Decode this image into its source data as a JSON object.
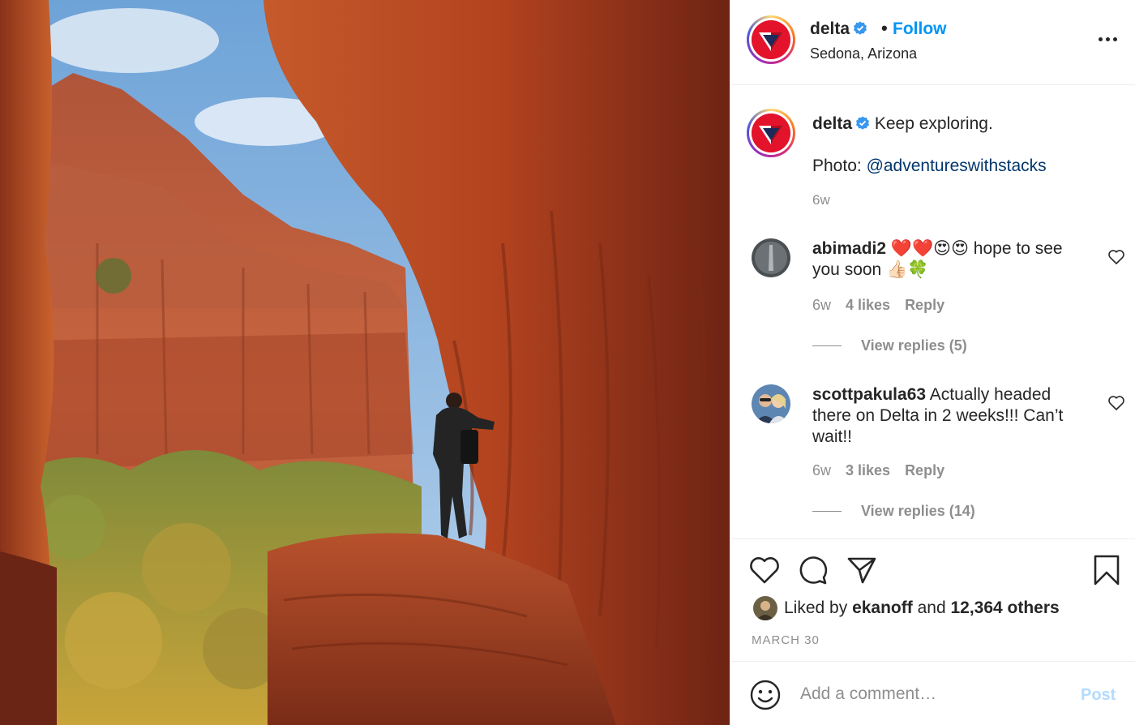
{
  "post": {
    "username": "delta",
    "verified": true,
    "follow_dot": "•",
    "follow_label": "Follow",
    "location": "Sedona, Arizona",
    "more_icon": "more-options-icon",
    "photo_alt": "Photo by Delta in Sedona, Arizona"
  },
  "caption": {
    "username": "delta",
    "text": "Keep exploring.",
    "photo_prefix": "Photo: ",
    "photo_mention": "@adventureswithstacks",
    "time": "6w"
  },
  "comments": [
    {
      "username": "abimadi2",
      "text": "❤️❤️😍😍 hope to see you soon 👍🏻🍀",
      "time": "6w",
      "likes": "4 likes",
      "reply_label": "Reply",
      "view_replies": "View replies (5)"
    },
    {
      "username": "scottpakula63",
      "text": "Actually headed there on Delta in 2 weeks!!! Can’t wait!!",
      "time": "6w",
      "likes": "3 likes",
      "reply_label": "Reply",
      "view_replies": "View replies (14)"
    }
  ],
  "actions": {
    "icons": [
      "heart-icon",
      "comment-icon",
      "share-icon",
      "bookmark-icon"
    ],
    "liked_prefix": "Liked by ",
    "liked_user": "ekanoff",
    "liked_and": " and ",
    "liked_count": "12,364 others",
    "date": "MARCH 30"
  },
  "add_comment": {
    "placeholder": "Add a comment…",
    "post_label": "Post"
  },
  "colors": {
    "accent": "#0095f6",
    "link": "#00376b",
    "muted": "#8e8e8e",
    "post_disabled": "#b3dbff",
    "delta_red": "#e3132c"
  }
}
